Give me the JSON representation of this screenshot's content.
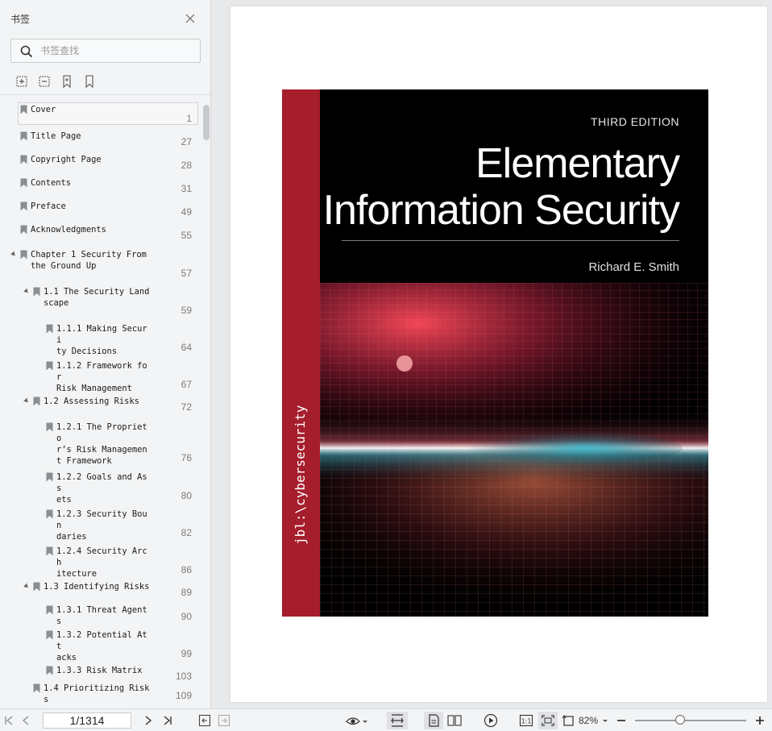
{
  "sidebar": {
    "title": "书签",
    "search_placeholder": "书签查找",
    "bookmarks": [
      {
        "label": "Cover",
        "page": "1"
      },
      {
        "label": "Title Page",
        "page": "27"
      },
      {
        "label": "Copyright Page",
        "page": "28"
      },
      {
        "label": "Contents",
        "page": "31"
      },
      {
        "label": "Preface",
        "page": "49"
      },
      {
        "label": "Acknowledgments",
        "page": "55"
      },
      {
        "label": "Chapter 1 Security From\nthe Ground Up",
        "page": "57"
      },
      {
        "label": "1.1 The Security Land\nscape",
        "page": "59"
      },
      {
        "label": "1.1.1 Making Securi\nty Decisions",
        "page": "64"
      },
      {
        "label": "1.1.2 Framework for\nRisk Management",
        "page": "67"
      },
      {
        "label": "1.2 Assessing Risks",
        "page": "72"
      },
      {
        "label": "1.2.1 The Proprieto\nr’s Risk Managemen\nt Framework",
        "page": "76"
      },
      {
        "label": "1.2.2 Goals and Ass\nets",
        "page": "80"
      },
      {
        "label": "1.2.3 Security Boun\ndaries",
        "page": "82"
      },
      {
        "label": "1.2.4 Security Arch\nitecture",
        "page": "86"
      },
      {
        "label": "1.3 Identifying Risks",
        "page": "89"
      },
      {
        "label": "1.3.1 Threat Agents",
        "page": "90"
      },
      {
        "label": "1.3.2 Potential Att\nacks",
        "page": "99"
      },
      {
        "label": "1.3.3 Risk Matrix",
        "page": "103"
      },
      {
        "label": "1.4 Prioritizing Risk\ns",
        "page": "109"
      }
    ]
  },
  "cover": {
    "edition": "THIRD EDITION",
    "title_line1": "Elementary",
    "title_line2": "Information Security",
    "author": "Richard E. Smith",
    "spine_text": "jbl:\\cybersecurity",
    "band_color": "#a61d2c"
  },
  "bottombar": {
    "page_indicator": "1/1314",
    "zoom": "82%"
  }
}
